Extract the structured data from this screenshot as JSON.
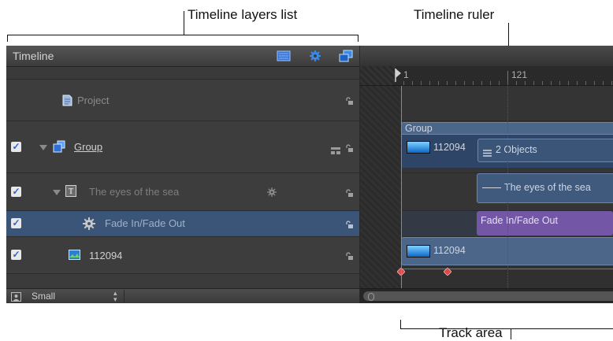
{
  "callouts": {
    "layers_list": "Timeline layers list",
    "ruler": "Timeline ruler",
    "track_area": "Track area"
  },
  "panel": {
    "title": "Timeline",
    "toolbar_icons": [
      "filmstrip-view-icon",
      "gear-icon",
      "layers-icon"
    ]
  },
  "layers": [
    {
      "name": "Project",
      "icon": "project-icon",
      "checked": false
    },
    {
      "name": "Group",
      "icon": "group-icon",
      "checked": true
    },
    {
      "name": "The eyes of the sea",
      "icon": "text-layer-icon",
      "checked": true
    },
    {
      "name": "Fade In/Fade Out",
      "icon": "behavior-gear-icon",
      "checked": true
    },
    {
      "name": "112094",
      "icon": "image-icon",
      "checked": true
    }
  ],
  "bottom_bar": {
    "size_label": "Small"
  },
  "ruler": {
    "marks": [
      "1",
      "121"
    ]
  },
  "tracks": {
    "group_label": "Group",
    "group_image": "112094",
    "group_objects": "2 Objects",
    "text_bar": "The eyes of the sea",
    "behavior_bar": "Fade In/Fade Out",
    "image_bar": "112094"
  },
  "colors": {
    "selected_row": "#3b5578",
    "group_track": "#4f6a8f",
    "behavior_track": "#7357a6",
    "keyframe": "#d94a4a"
  }
}
